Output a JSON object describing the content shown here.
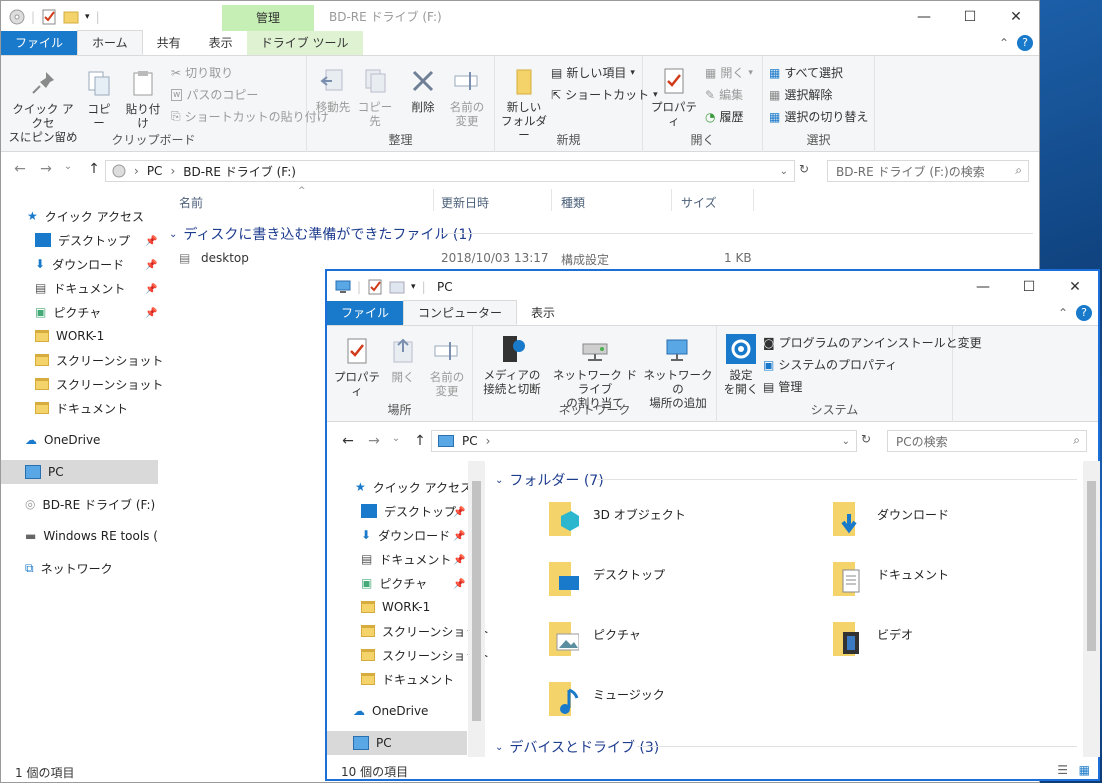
{
  "win1": {
    "title": "BD-RE ドライブ (F:)",
    "context_tab": "管理",
    "tabs": [
      "ファイル",
      "ホーム",
      "共有",
      "表示",
      "ドライブ ツール"
    ],
    "ribbon": {
      "clipboard": {
        "label": "クリップボード",
        "pin": "クイック アクセ\nスにピン留め",
        "copy": "コピー",
        "paste": "貼り付け",
        "cut": "切り取り",
        "copy_path": "パスのコピー",
        "paste_shortcut": "ショートカットの貼り付け"
      },
      "organize": {
        "label": "整理",
        "move": "移動先",
        "copyto": "コピー先",
        "delete": "削除",
        "rename": "名前の\n変更"
      },
      "new": {
        "label": "新規",
        "new_folder": "新しい\nフォルダー",
        "new_item": "新しい項目",
        "shortcut": "ショートカット"
      },
      "open": {
        "label": "開く",
        "properties": "プロパティ",
        "open": "開く",
        "edit": "編集",
        "history": "履歴"
      },
      "select": {
        "label": "選択",
        "all": "すべて選択",
        "none": "選択解除",
        "invert": "選択の切り替え"
      }
    },
    "address": {
      "pc": "PC",
      "drive": "BD-RE ドライブ (F:)"
    },
    "search_placeholder": "BD-RE ドライブ (F:)の検索",
    "columns": [
      "名前",
      "更新日時",
      "種類",
      "サイズ"
    ],
    "group_header": "ディスクに書き込む準備ができたファイル (1)",
    "files": [
      {
        "name": "desktop",
        "date": "2018/10/03 13:17",
        "type": "構成設定",
        "size": "1 KB"
      }
    ],
    "nav": {
      "quick": "クイック アクセス",
      "items": [
        "デスクトップ",
        "ダウンロード",
        "ドキュメント",
        "ピクチャ",
        "WORK-1",
        "スクリーンショット",
        "スクリーンショット",
        "ドキュメント"
      ],
      "onedrive": "OneDrive",
      "pc": "PC",
      "bd": "BD-RE ドライブ (F:)",
      "winre": "Windows RE tools (E:",
      "network": "ネットワーク"
    },
    "status": "1 個の項目"
  },
  "win2": {
    "title": "PC",
    "tabs": [
      "ファイル",
      "コンピューター",
      "表示"
    ],
    "ribbon": {
      "location": {
        "label": "場所",
        "properties": "プロパティ",
        "open": "開く",
        "rename": "名前の\n変更"
      },
      "network": {
        "label": "ネットワーク",
        "media": "メディアの\n接続と切断",
        "map": "ネットワーク ドライブ\nの割り当て",
        "add": "ネットワークの\n場所の追加"
      },
      "system": {
        "label": "システム",
        "settings": "設定\nを開く",
        "uninstall": "プログラムのアンインストールと変更",
        "sysprops": "システムのプロパティ",
        "manage": "管理"
      }
    },
    "address": {
      "pc": "PC"
    },
    "search_placeholder": "PCの検索",
    "nav": {
      "quick": "クイック アクセス",
      "items": [
        "デスクトップ",
        "ダウンロード",
        "ドキュメント",
        "ピクチャ",
        "WORK-1",
        "スクリーンショット",
        "スクリーンショット",
        "ドキュメント"
      ],
      "onedrive": "OneDrive",
      "pc": "PC"
    },
    "folders_header": "フォルダー (7)",
    "folders": [
      "3D オブジェクト",
      "ダウンロード",
      "デスクトップ",
      "ドキュメント",
      "ピクチャ",
      "ビデオ",
      "ミュージック"
    ],
    "devices_header": "デバイスとドライブ (3)",
    "status": "10 個の項目"
  }
}
